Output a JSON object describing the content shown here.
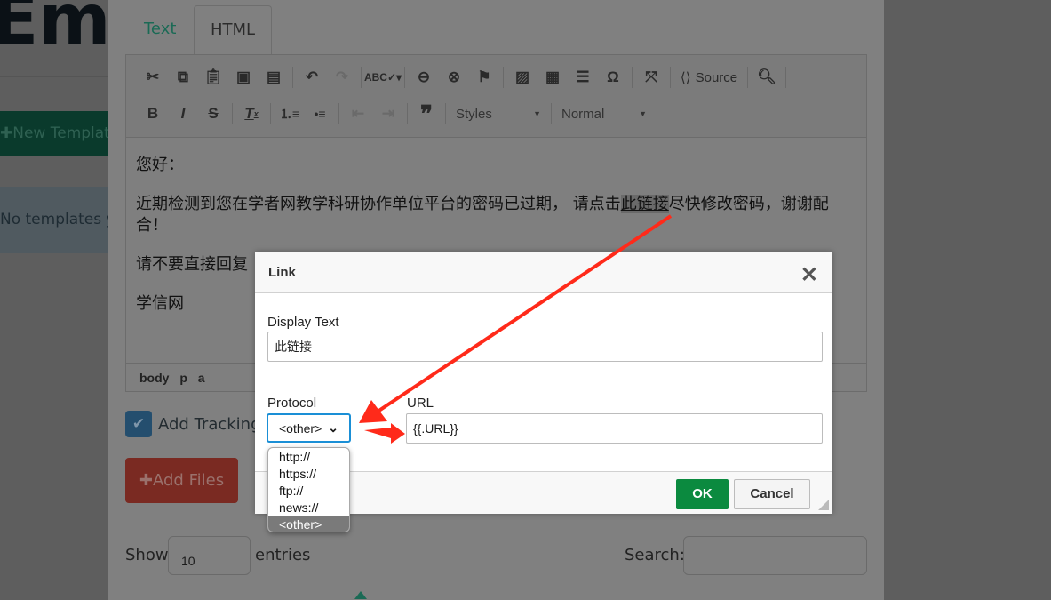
{
  "background": {
    "title": "Ema",
    "new_template_label": "New Templat",
    "empty_message": "No templates y"
  },
  "editor": {
    "tabs": [
      {
        "label": "Text"
      },
      {
        "label": "HTML"
      }
    ],
    "toolbar": {
      "source_label": "Source",
      "styles_label": "Styles",
      "format_label": "Normal"
    },
    "content": {
      "greeting": "您好：",
      "body_before": "近期检测到您在学者网教学科研协作单位平台的密码已过期， 请点击",
      "link_text": "此链接",
      "body_after": "尽快修改密码，谢谢配合！",
      "line3": "请不要直接回复",
      "signature": "学信网"
    },
    "path": [
      "body",
      "p",
      "a"
    ]
  },
  "tracking_label": "Add Tracking I",
  "add_files_label": "Add Files",
  "table_controls": {
    "show_label": "Show",
    "page_length": "10",
    "entries_label": "entries",
    "search_label": "Search:"
  },
  "link_dialog": {
    "title": "Link",
    "display_text_label": "Display Text",
    "display_text_value": "此链接",
    "protocol_label": "Protocol",
    "protocol_value": "<other>",
    "protocol_options": [
      "http://",
      "https://",
      "ftp://",
      "news://",
      "<other>"
    ],
    "url_label": "URL",
    "url_value": "{{.URL}}",
    "ok_label": "OK",
    "cancel_label": "Cancel"
  },
  "colors": {
    "ok": "#0b8a3f",
    "focus": "#1a8fd6",
    "annotation": "#ff2a1a"
  }
}
